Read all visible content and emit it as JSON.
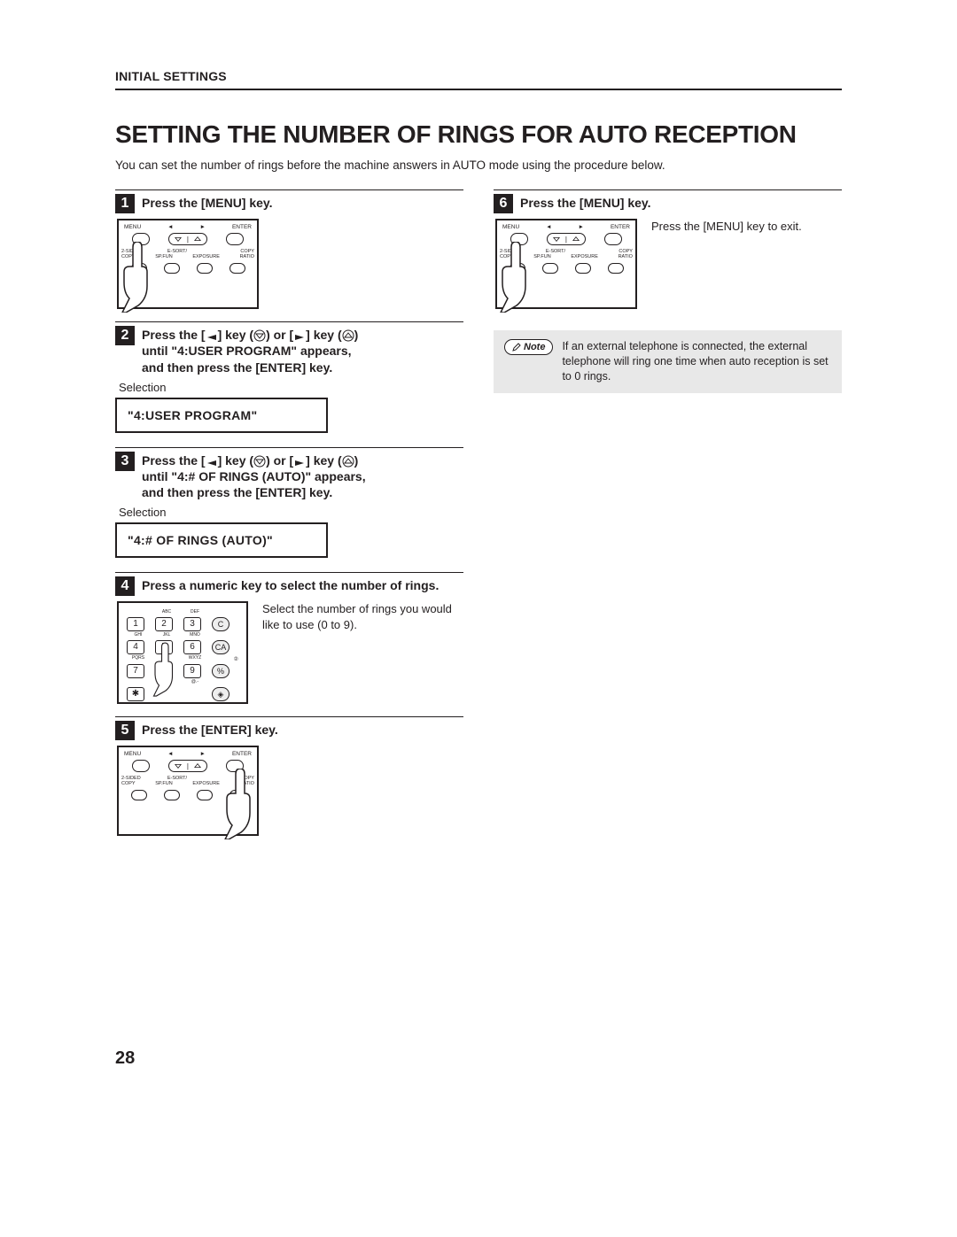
{
  "header": {
    "section": "INITIAL SETTINGS"
  },
  "title": "SETTING THE NUMBER OF RINGS FOR AUTO RECEPTION",
  "intro": "You can set the number of rings before the machine answers in AUTO mode using the procedure below.",
  "steps": {
    "s1": {
      "num": "1",
      "title": "Press the [MENU] key."
    },
    "s2": {
      "num": "2",
      "title_parts": {
        "a": "Press the [",
        "b": "] key (",
        "c": ") or [",
        "d": "] key (",
        "e": ")",
        "line2": "until \"4:USER PROGRAM\" appears,",
        "line3": "and then press the [ENTER] key."
      },
      "selection_label": "Selection",
      "lcd": "\"4:USER PROGRAM\""
    },
    "s3": {
      "num": "3",
      "title_parts": {
        "a": "Press the [",
        "b": "] key (",
        "c": ") or [",
        "d": "] key (",
        "e": ")",
        "line2": "until \"4:# OF RINGS (AUTO)\" appears,",
        "line3": "and then press the [ENTER] key."
      },
      "selection_label": "Selection",
      "lcd": "\"4:# OF RINGS (AUTO)\""
    },
    "s4": {
      "num": "4",
      "title": "Press a numeric key to select the number of rings.",
      "side": "Select the number of rings you would like to use (0 to 9)."
    },
    "s5": {
      "num": "5",
      "title": "Press the [ENTER] key."
    },
    "s6": {
      "num": "6",
      "title": "Press the [MENU] key.",
      "side": "Press the [MENU] key to exit."
    }
  },
  "panel": {
    "top_labels": {
      "menu": "MENU",
      "enter": "ENTER"
    },
    "bot_labels": {
      "a": "2-SIDED",
      "b": "E-SORT/",
      "c": "",
      "d": "COPY",
      "a2": "COPY",
      "b2": "SP.FUN",
      "c2": "EXPOSURE",
      "d2": "RATIO"
    }
  },
  "keypad": {
    "labels": {
      "abc": "ABC",
      "def": "DEF",
      "ghi": "GHI",
      "jkl": "JKL",
      "mno": "MNO",
      "pqrs": "PQRS",
      "wxyz": "WXYZ",
      "at": "@.-"
    },
    "keys": {
      "1": "1",
      "2": "2",
      "3": "3",
      "4": "4",
      "5": "5",
      "6": "6",
      "7": "7",
      "9": "9",
      "c": "C",
      "ca": "CA",
      "star": "✱"
    }
  },
  "note": {
    "label": "Note",
    "text": "If an external telephone is connected, the external telephone will ring one time when auto reception is set to 0 rings."
  },
  "page_number": "28"
}
